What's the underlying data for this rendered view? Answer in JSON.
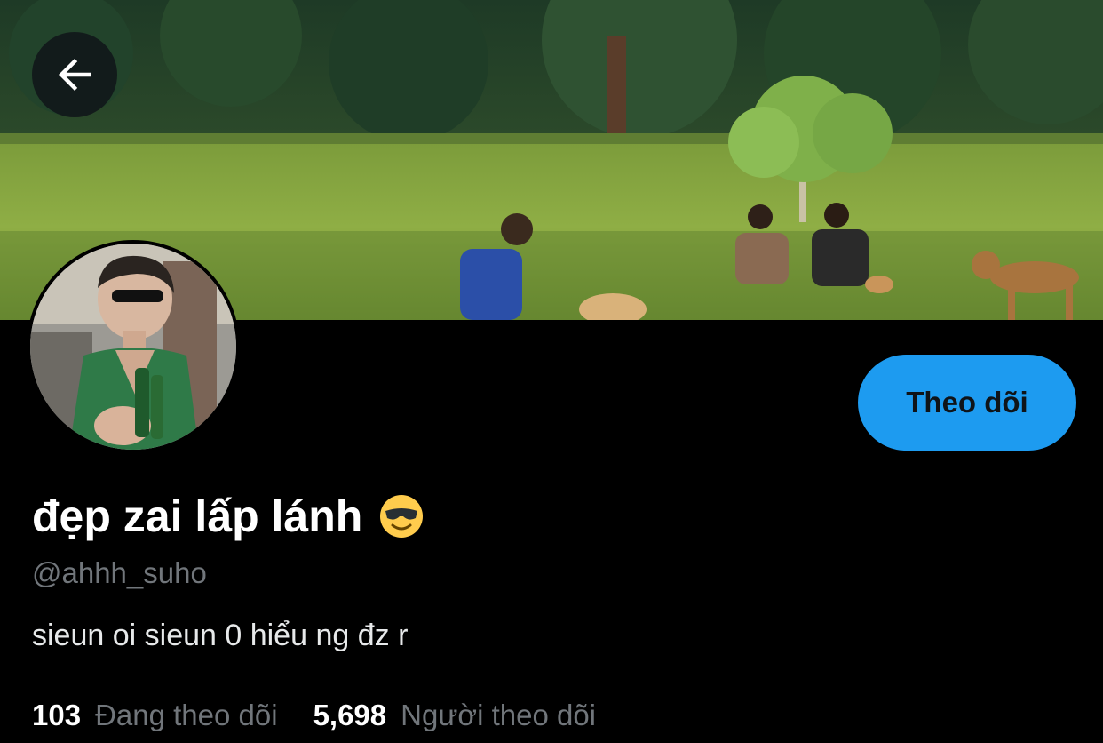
{
  "header": {
    "back_icon": "arrow-left-icon"
  },
  "profile": {
    "display_name": "đẹp zai lấp lánh",
    "name_emoji": "smiling-face-with-sunglasses",
    "handle": "@ahhh_suho",
    "bio": "sieun oi sieun 0 hiểu ng đz r",
    "follow_label": "Theo dõi"
  },
  "stats": {
    "following_count": "103",
    "following_label": "Đang theo dõi",
    "followers_count": "5,698",
    "followers_label": "Người theo dõi"
  },
  "colors": {
    "background": "#000000",
    "accent": "#1d9bf0",
    "secondary_text": "#71767b",
    "primary_text": "#e7e9ea"
  }
}
